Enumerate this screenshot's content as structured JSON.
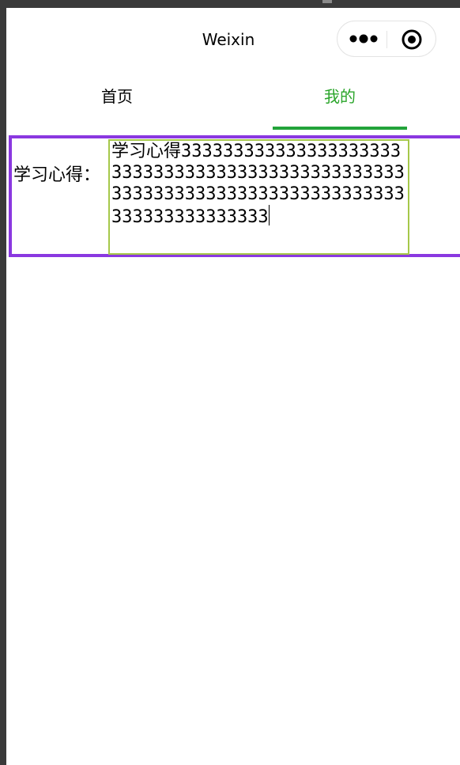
{
  "navbar": {
    "title": "Weixin",
    "menu_icon": "more-dots-icon",
    "close_icon": "target-circle-icon"
  },
  "tabs": [
    {
      "label": "首页",
      "active": false
    },
    {
      "label": "我的",
      "active": true
    }
  ],
  "form": {
    "label": "学习心得：",
    "textarea_value": "学习心得33333333333333333333333333333333333333333333333333333333333333333333333333333333333333333333",
    "colors": {
      "row_border": "#8a38e0",
      "textarea_border": "#a6c84a",
      "active_tab": "#2aa52a"
    }
  }
}
